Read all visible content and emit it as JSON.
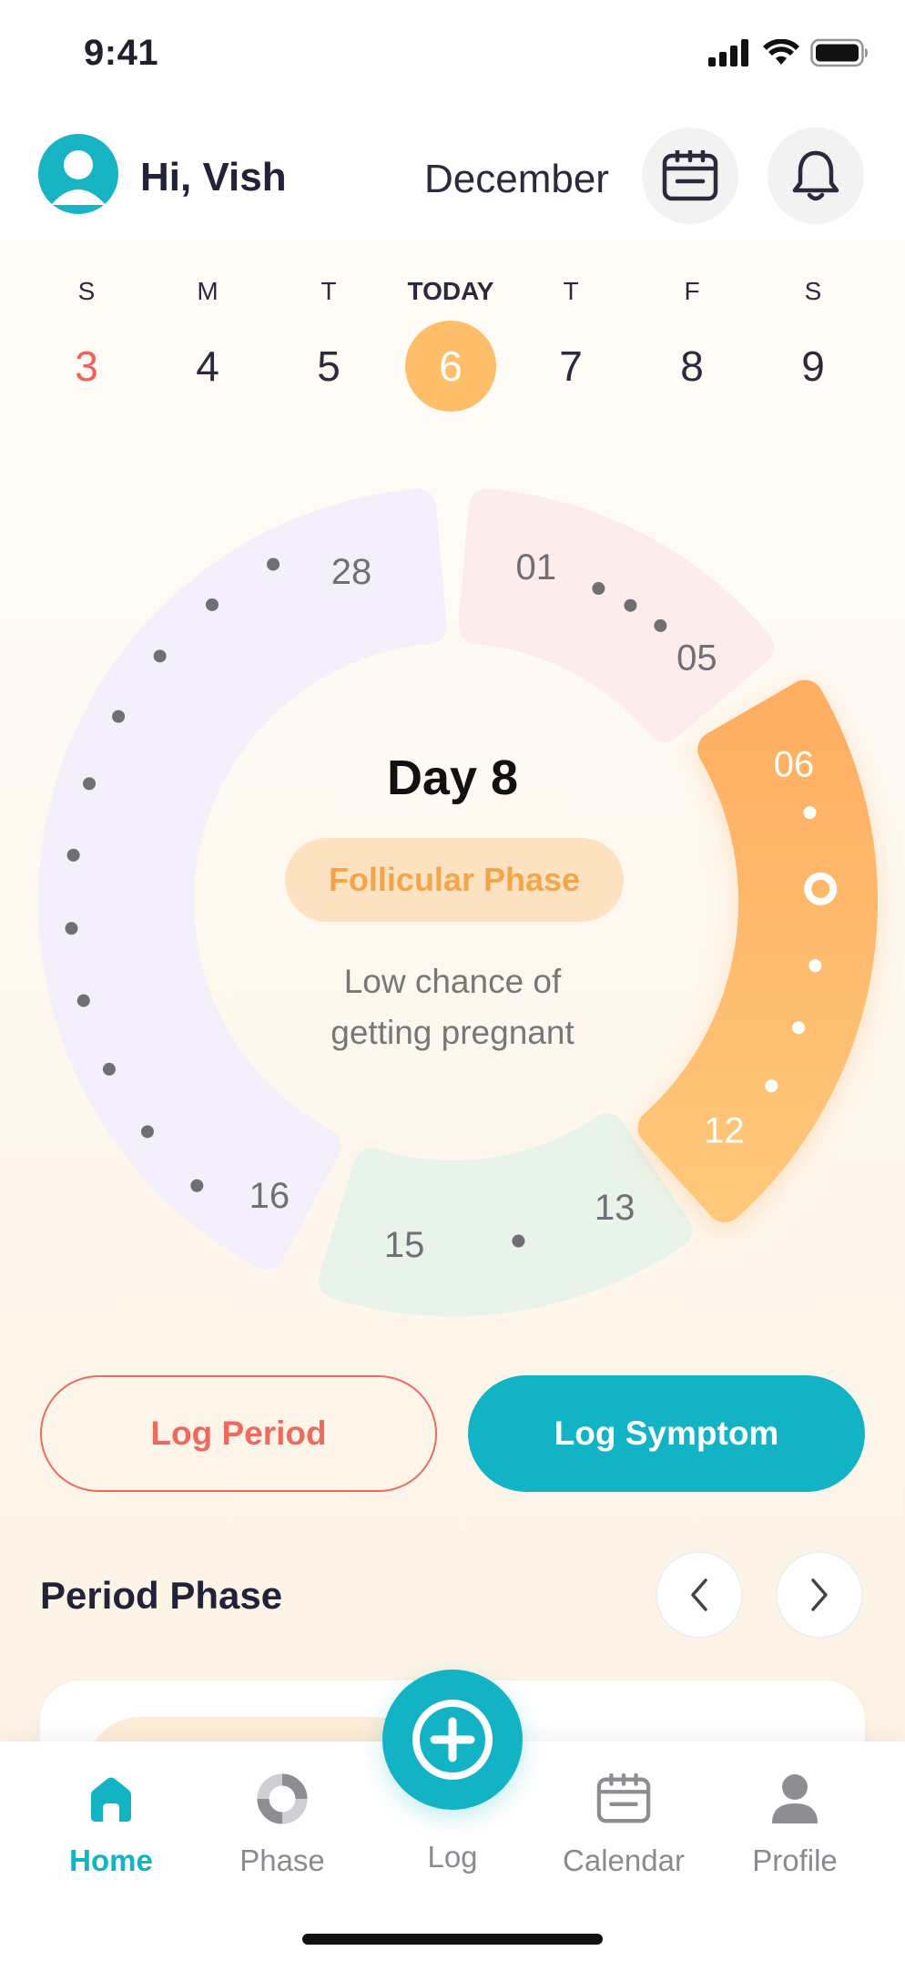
{
  "status_bar": {
    "time": "9:41"
  },
  "header": {
    "greeting": "Hi, Vish",
    "month": "December",
    "calendar_icon": "calendar-icon",
    "bell_icon": "bell-icon"
  },
  "week": {
    "days": [
      {
        "name": "S",
        "date": "3"
      },
      {
        "name": "M",
        "date": "4"
      },
      {
        "name": "T",
        "date": "5"
      },
      {
        "name": "TODAY",
        "date": "6"
      },
      {
        "name": "T",
        "date": "7"
      },
      {
        "name": "F",
        "date": "8"
      },
      {
        "name": "S",
        "date": "9"
      }
    ]
  },
  "cycle": {
    "day_label": "Day 8",
    "phase": "Follicular Phase",
    "chance_line1": "Low chance of",
    "chance_line2": "getting pregnant",
    "segments": {
      "period": {
        "start": "01",
        "end": "05",
        "color": "#fcecea"
      },
      "follicular": {
        "start": "06",
        "end": "12",
        "color": "#fdb062"
      },
      "ovulation": {
        "start": "13",
        "end": "15",
        "color": "#e8f3ea"
      },
      "luteal": {
        "start": "16",
        "end": "28",
        "color": "#f3effb"
      }
    }
  },
  "actions": {
    "log_period": "Log Period",
    "log_symptom": "Log Symptom"
  },
  "section": {
    "title": "Period Phase"
  },
  "tabs": {
    "home": "Home",
    "phase": "Phase",
    "log": "Log",
    "calendar": "Calendar",
    "profile": "Profile"
  },
  "colors": {
    "accent": "#12b3c5",
    "today": "#ffbf6a",
    "period": "#ec6a5e"
  }
}
